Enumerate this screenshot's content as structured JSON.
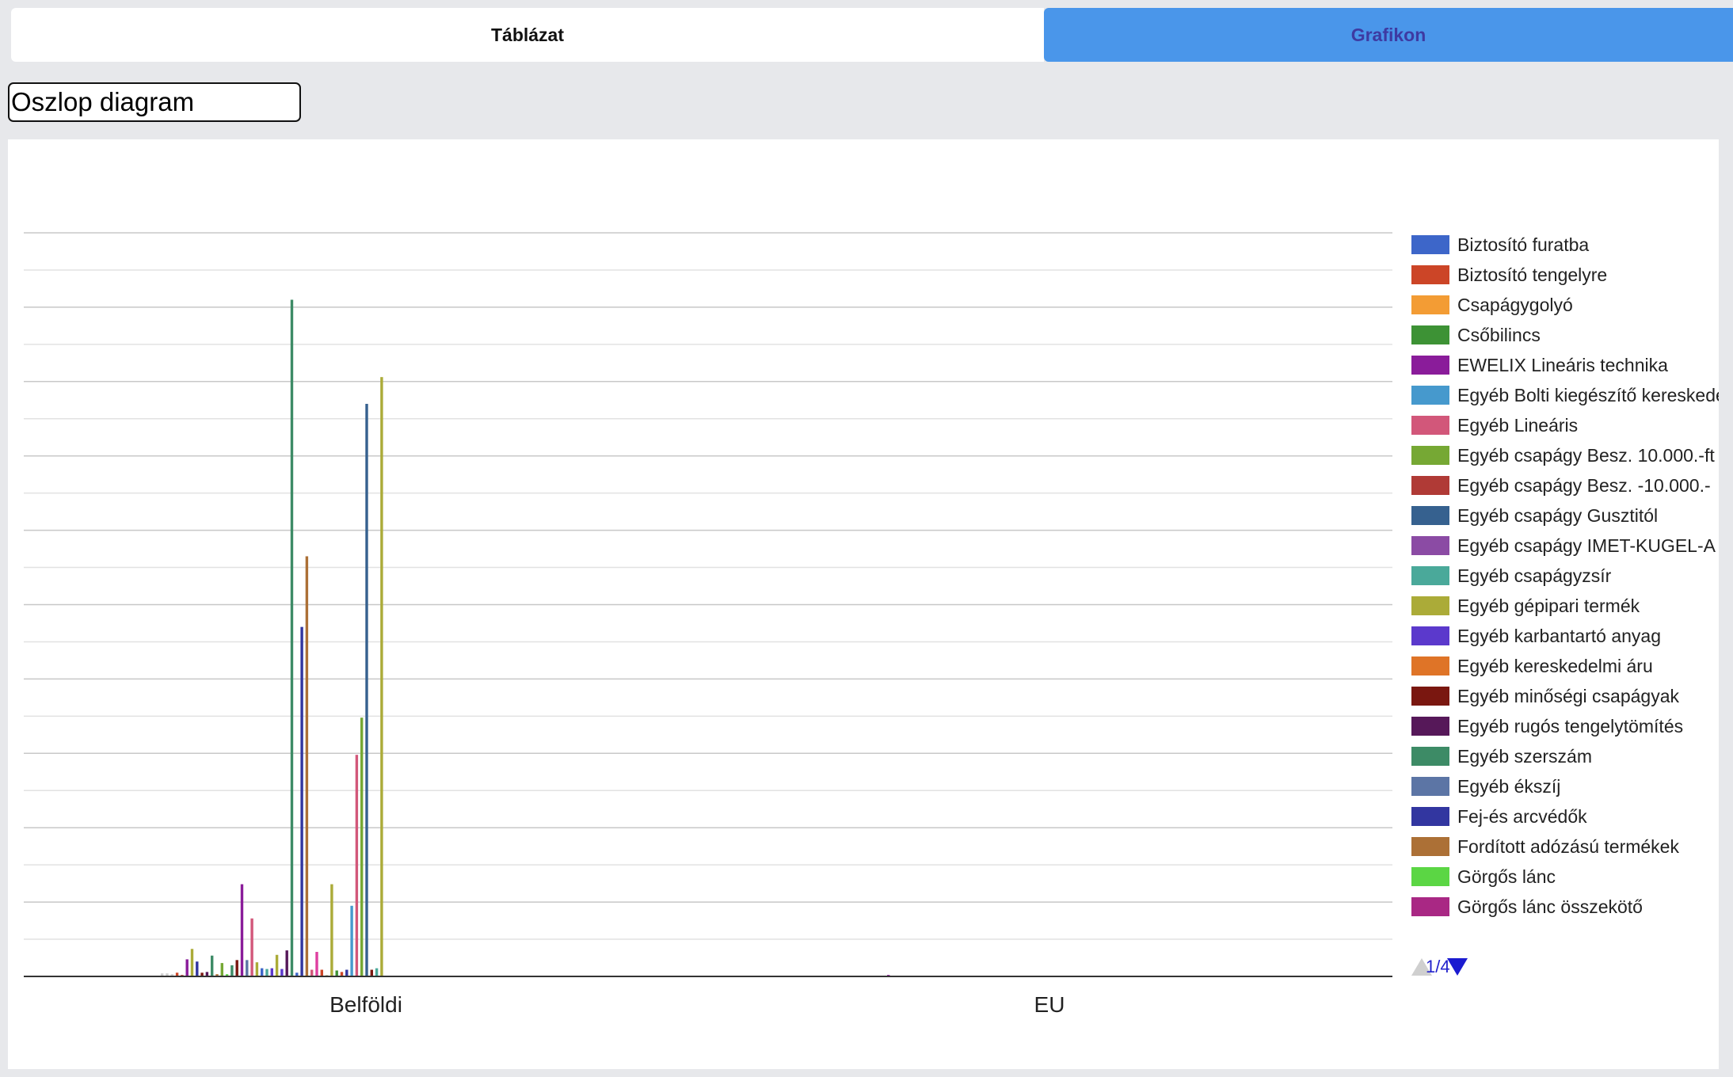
{
  "tabs": {
    "table_label": "Táblázat",
    "chart_label": "Grafikon"
  },
  "chart_type_select": {
    "value": "Oszlop diagram"
  },
  "legend_pager": {
    "text": "1/4"
  },
  "chart_data": {
    "type": "bar",
    "title": "",
    "xlabel": "",
    "ylabel": "",
    "categories": [
      "Belföldi",
      "EU"
    ],
    "ylim": [
      0,
      1000
    ],
    "grid": true,
    "legend_position": "right",
    "series": [
      {
        "name": "Biztosító furatba",
        "color": "#3d66c9",
        "values": [
          0,
          0
        ]
      },
      {
        "name": "Biztosító tengelyre",
        "color": "#cc4527",
        "values": [
          0,
          0
        ]
      },
      {
        "name": "Csapágygolyó",
        "color": "#f39c34",
        "values": [
          0,
          0
        ]
      },
      {
        "name": "Csőbilincs",
        "color": "#3d9235",
        "values": [
          0,
          0
        ]
      },
      {
        "name": "EWELIX Lineáris technika",
        "color": "#8a1c9a",
        "values": [
          0,
          2
        ]
      },
      {
        "name": "Egyéb Bolti kiegészítő kereskedelmi",
        "color": "#4699cd",
        "values": [
          0,
          0
        ]
      },
      {
        "name": "Egyéb Lineáris",
        "color": "#d2577a",
        "values": [
          0,
          0
        ]
      },
      {
        "name": "Egyéb csapágy Besz. 10.000.-ft",
        "color": "#76a834",
        "values": [
          0,
          0
        ]
      },
      {
        "name": "Egyéb csapágy Besz. -10.000.-",
        "color": "#b03a36",
        "values": [
          0,
          0
        ]
      },
      {
        "name": "Egyéb csapágy Gusztitól",
        "color": "#36618f",
        "values": [
          0,
          0
        ]
      },
      {
        "name": "Egyéb csapágy IMET-KUGEL-A",
        "color": "#8b4ba4",
        "values": [
          0,
          0
        ]
      },
      {
        "name": "Egyéb csapágyzsír",
        "color": "#4aa99a",
        "values": [
          0,
          0
        ]
      },
      {
        "name": "Egyéb gépipari termék",
        "color": "#abab38",
        "values": [
          0,
          0
        ]
      },
      {
        "name": "Egyéb karbantartó anyag",
        "color": "#5b39cc",
        "values": [
          0,
          0
        ]
      },
      {
        "name": "Egyéb kereskedelmi áru",
        "color": "#df7427",
        "values": [
          0,
          0
        ]
      },
      {
        "name": "Egyéb minőségi csapágyak",
        "color": "#7a1710",
        "values": [
          0,
          0
        ]
      },
      {
        "name": "Egyéb rugós tengelytömítés",
        "color": "#561859",
        "values": [
          0,
          0
        ]
      },
      {
        "name": "Egyéb szerszám",
        "color": "#3d8b66",
        "values": [
          0,
          0
        ]
      },
      {
        "name": "Egyéb ékszíj",
        "color": "#5c75a5",
        "values": [
          0,
          0
        ]
      },
      {
        "name": "Fej-és arcvédők",
        "color": "#3236a0",
        "values": [
          0,
          0
        ]
      },
      {
        "name": "Fordított adózású termékek",
        "color": "#ac7036",
        "values": [
          0,
          0
        ]
      },
      {
        "name": "Görgős lánc",
        "color": "#5bd644",
        "values": [
          0,
          0
        ]
      },
      {
        "name": "Görgős lánc összekötő",
        "color": "#a92884",
        "values": [
          0,
          0
        ]
      }
    ],
    "bars_group_0": [
      [
        "#cccccc",
        4
      ],
      [
        "#cccccc",
        4
      ],
      [
        "#cccccc",
        3
      ],
      [
        "#cc4527",
        5
      ],
      [
        "#b03a36",
        2
      ],
      [
        "#8a1c9a",
        23
      ],
      [
        "#abab38",
        37
      ],
      [
        "#3236a0",
        20
      ],
      [
        "#7a1710",
        5
      ],
      [
        "#561859",
        6
      ],
      [
        "#3d8b66",
        28
      ],
      [
        "#ac7036",
        3
      ],
      [
        "#76a834",
        18
      ],
      [
        "#5bd644",
        3
      ],
      [
        "#3d8b66",
        15
      ],
      [
        "#7a1710",
        22
      ],
      [
        "#8a1c9a",
        124
      ],
      [
        "#5c75a5",
        22
      ],
      [
        "#d2577a",
        78
      ],
      [
        "#abab38",
        19
      ],
      [
        "#3d66c9",
        11
      ],
      [
        "#4aa99a",
        10
      ],
      [
        "#5b39cc",
        11
      ],
      [
        "#abab38",
        29
      ],
      [
        "#5b39cc",
        10
      ],
      [
        "#561859",
        35
      ],
      [
        "#3d8b66",
        910
      ],
      [
        "#3d66c9",
        5
      ],
      [
        "#3236a0",
        470
      ],
      [
        "#ac7036",
        565
      ],
      [
        "#d2577a",
        9
      ],
      [
        "#df3fa0",
        33
      ],
      [
        "#cc4527",
        9
      ],
      [
        "#d2c8a0",
        2
      ],
      [
        "#abab38",
        124
      ],
      [
        "#3d9235",
        8
      ],
      [
        "#cc4527",
        6
      ],
      [
        "#3236a0",
        9
      ],
      [
        "#4699cd",
        95
      ],
      [
        "#d2577a",
        298
      ],
      [
        "#76a834",
        348
      ],
      [
        "#36618f",
        770
      ],
      [
        "#7a1710",
        9
      ],
      [
        "#4aa99a",
        11
      ],
      [
        "#abab38",
        806
      ]
    ]
  }
}
